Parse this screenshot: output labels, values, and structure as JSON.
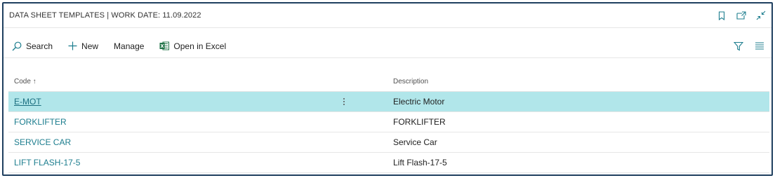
{
  "window": {
    "title": "DATA SHEET TEMPLATES | WORK DATE: 11.09.2022",
    "icons": [
      "bookmark-icon",
      "open-new-window-icon",
      "collapse-icon"
    ]
  },
  "actions": {
    "search_label": "Search",
    "new_label": "New",
    "manage_label": "Manage",
    "excel_label": "Open in Excel",
    "right_icons": [
      "filter-icon",
      "list-view-icon"
    ]
  },
  "table": {
    "columns": {
      "code": "Code ↑",
      "description": "Description"
    },
    "rows": [
      {
        "code": "E-MOT",
        "description": "Electric Motor",
        "selected": true
      },
      {
        "code": "FORKLIFTER",
        "description": "FORKLIFTER",
        "selected": false
      },
      {
        "code": "SERVICE CAR",
        "description": "Service Car",
        "selected": false
      },
      {
        "code": "LIFT FLASH-17-5",
        "description": "Lift Flash-17-5",
        "selected": false
      }
    ]
  },
  "colors": {
    "accent": "#1c7d8e",
    "selected_row": "#b1e6ea",
    "frame_border": "#1f3f5f",
    "excel_green": "#1e7145"
  }
}
